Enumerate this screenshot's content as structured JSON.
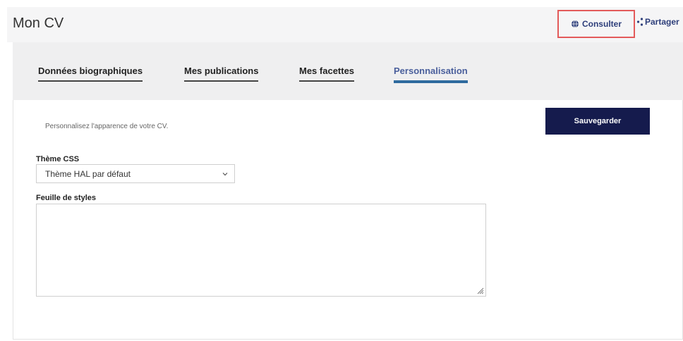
{
  "header": {
    "title": "Mon CV",
    "consult_label": "Consulter",
    "share_label": "Partager"
  },
  "tabs": [
    {
      "label": "Données biographiques",
      "active": false
    },
    {
      "label": "Mes publications",
      "active": false
    },
    {
      "label": "Mes facettes",
      "active": false
    },
    {
      "label": "Personnalisation",
      "active": true
    }
  ],
  "panel": {
    "intro": "Personnalisez l'apparence de votre CV.",
    "save_label": "Sauvegarder",
    "theme_label": "Thème CSS",
    "theme_value": "Thème HAL par défaut",
    "stylesheet_label": "Feuille de styles",
    "stylesheet_value": ""
  },
  "colors": {
    "accent": "#2e6a9e",
    "save_button": "#151b4d",
    "highlight": "#e35a5a"
  },
  "icons": {
    "consult": "globe-icon",
    "share": "share-icon",
    "select": "chevron-down-icon",
    "textarea": "resize-grip-icon"
  }
}
